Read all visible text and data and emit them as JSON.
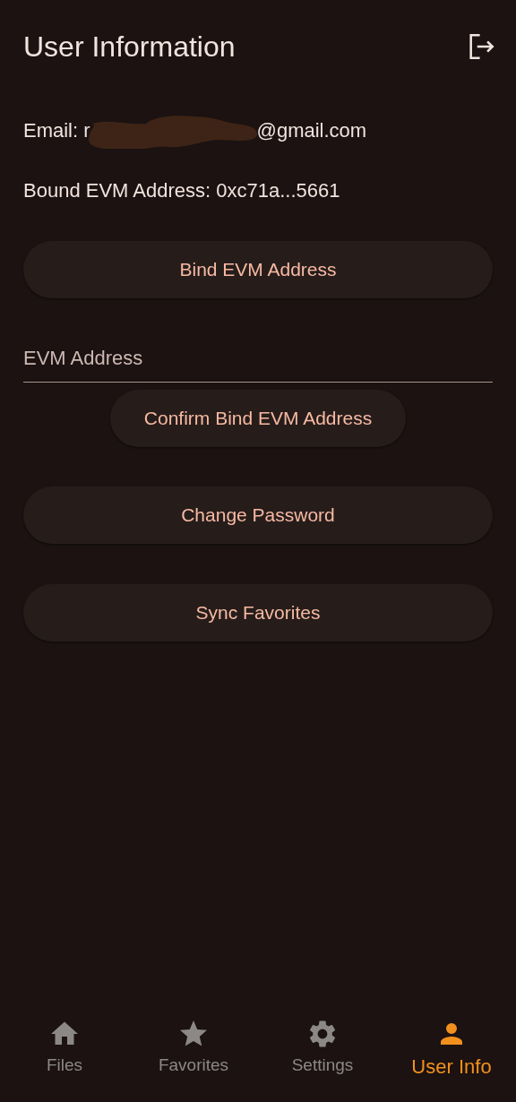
{
  "app_bar": {
    "title": "User Information"
  },
  "email": {
    "label_start": "Email: r",
    "label_end": "@gmail.com"
  },
  "bound_address": "Bound EVM Address: 0xc71a...5661",
  "bind_button": "Bind EVM Address",
  "evm_field": {
    "placeholder": "EVM Address"
  },
  "confirm_button": "Confirm Bind EVM Address",
  "actions": [
    "Change Password",
    "Sync Favorites"
  ],
  "nav": [
    {
      "label": "Files",
      "kind": "home",
      "selected": false
    },
    {
      "label": "Favorites",
      "kind": "star",
      "selected": false
    },
    {
      "label": "Settings",
      "kind": "gear",
      "selected": false
    },
    {
      "label": "User Info",
      "kind": "person",
      "selected": true
    }
  ]
}
